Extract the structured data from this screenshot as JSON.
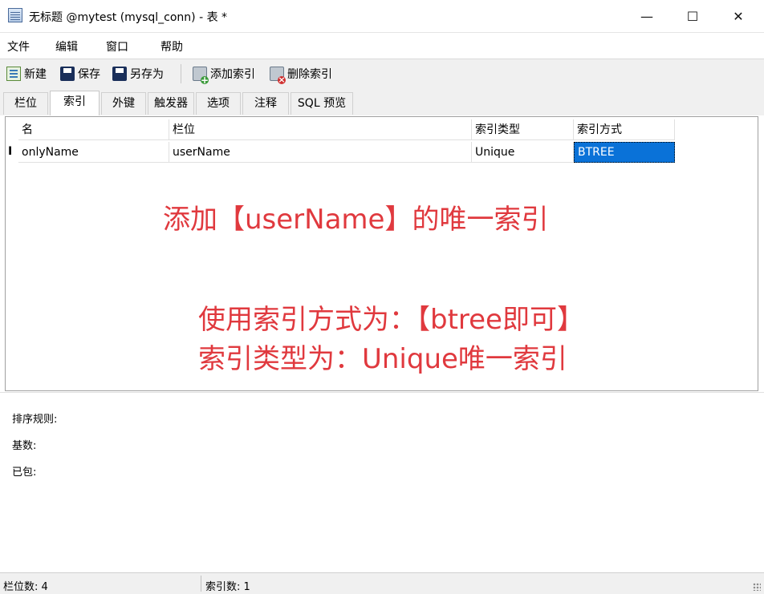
{
  "window": {
    "title": "无标题 @mytest (mysql_conn) - 表 *",
    "controls": {
      "minimize": "—",
      "maximize": "☐",
      "close": "✕"
    }
  },
  "menubar": {
    "items": [
      "文件",
      "编辑",
      "窗口",
      "帮助"
    ]
  },
  "toolbar": {
    "new_label": "新建",
    "save_label": "保存",
    "saveas_label": "另存为",
    "add_index_label": "添加索引",
    "delete_index_label": "删除索引"
  },
  "tabs": [
    "栏位",
    "索引",
    "外键",
    "触发器",
    "选项",
    "注释",
    "SQL 预览"
  ],
  "active_tab": "索引",
  "index_grid": {
    "columns": [
      "名",
      "栏位",
      "索引类型",
      "索引方式"
    ],
    "rows": [
      {
        "cursor": "I",
        "name": "onlyName",
        "fields": "userName",
        "type": "Unique",
        "method": "BTREE"
      }
    ]
  },
  "annotations": {
    "line1": "添加【userName】的唯一索引",
    "line2": "使用索引方式为：【btree即可】",
    "line3": "索引类型为：Unique唯一索引"
  },
  "details": {
    "collation_label": "排序规则:",
    "cardinality_label": "基数:",
    "packed_label": "已包:"
  },
  "statusbar": {
    "field_count": "栏位数: 4",
    "index_count": "索引数: 1"
  }
}
